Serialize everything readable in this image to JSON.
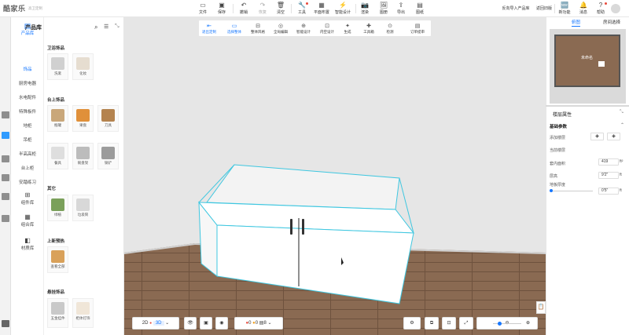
{
  "app": {
    "logo": "酷家乐",
    "subtitle": "高卫定制"
  },
  "toolbar": {
    "file": "文件",
    "save": "保存",
    "undo": "撤销",
    "redo": "恢复",
    "clear": "清空",
    "tools": "工具",
    "floor_layout": "平面布置",
    "smart_design": "智能设计",
    "render": "渲染",
    "gallery": "图册",
    "export": "导出",
    "drawings": "图纸",
    "reverse_import": "反向导入产品库",
    "back_old": "返回旧版",
    "new_features": "新功能",
    "messages": "消息",
    "help": "帮助"
  },
  "left_categories": [
    {
      "label": "产品库",
      "active": true
    },
    {
      "label": "饰品",
      "active": true
    },
    {
      "label": "厨房电器"
    },
    {
      "label": "水电配件"
    },
    {
      "label": "特殊板件"
    },
    {
      "label": "地柜"
    },
    {
      "label": "吊柜"
    },
    {
      "label": "半高高柜"
    },
    {
      "label": "台上柜"
    },
    {
      "label": "安踏练习"
    },
    {
      "label": "组件库"
    },
    {
      "label": "组合库"
    },
    {
      "label": "材质库"
    }
  ],
  "product_panel": {
    "title": "产品库",
    "sections": [
      {
        "title": "卫浴饰品",
        "items": [
          "洗漱",
          "化妆"
        ]
      },
      {
        "title": "台上饰品",
        "items": [
          "瓶罐",
          "果盘",
          "刀具",
          "餐具",
          "碗盘架",
          "锅铲"
        ]
      },
      {
        "title": "其它",
        "items": [
          "绿植",
          "垃圾筒"
        ]
      },
      {
        "title": "上新预热",
        "items": [
          "查看全部"
        ]
      },
      {
        "title": "悬挂饰品",
        "items": [
          "五金挂件",
          "柜体灯饰"
        ]
      }
    ]
  },
  "float_toolbar": [
    "退出定制",
    "选择整体",
    "整体风格",
    "全局编辑",
    "智能设计",
    "内空设计",
    "生成",
    "工具箱",
    "检测",
    "订单提审"
  ],
  "right_top": {
    "tab_view": "俯图",
    "tab_room": "房间选择",
    "room_name": "未命名"
  },
  "properties": {
    "title": "楼层属性",
    "section": "基础参数",
    "rows": [
      {
        "label": "添加楼层"
      },
      {
        "label": "当前楼层",
        "value": ""
      },
      {
        "label": "套内面积",
        "value": "419",
        "unit": "ft²"
      },
      {
        "label": "层高",
        "value": "9'2\"",
        "unit": "ft"
      },
      {
        "label": "地板厚度",
        "value": "0'5\"",
        "unit": "ft"
      }
    ]
  },
  "bottom": {
    "mode2d": "2D",
    "mode3d": "3D",
    "warn_red": "0",
    "warn_orange": "0",
    "layers": "8"
  },
  "colors": {
    "accent": "#1677ff",
    "outline": "#3fc7e0",
    "wall": "#e6e6e6",
    "floor": "#8a6a52"
  }
}
